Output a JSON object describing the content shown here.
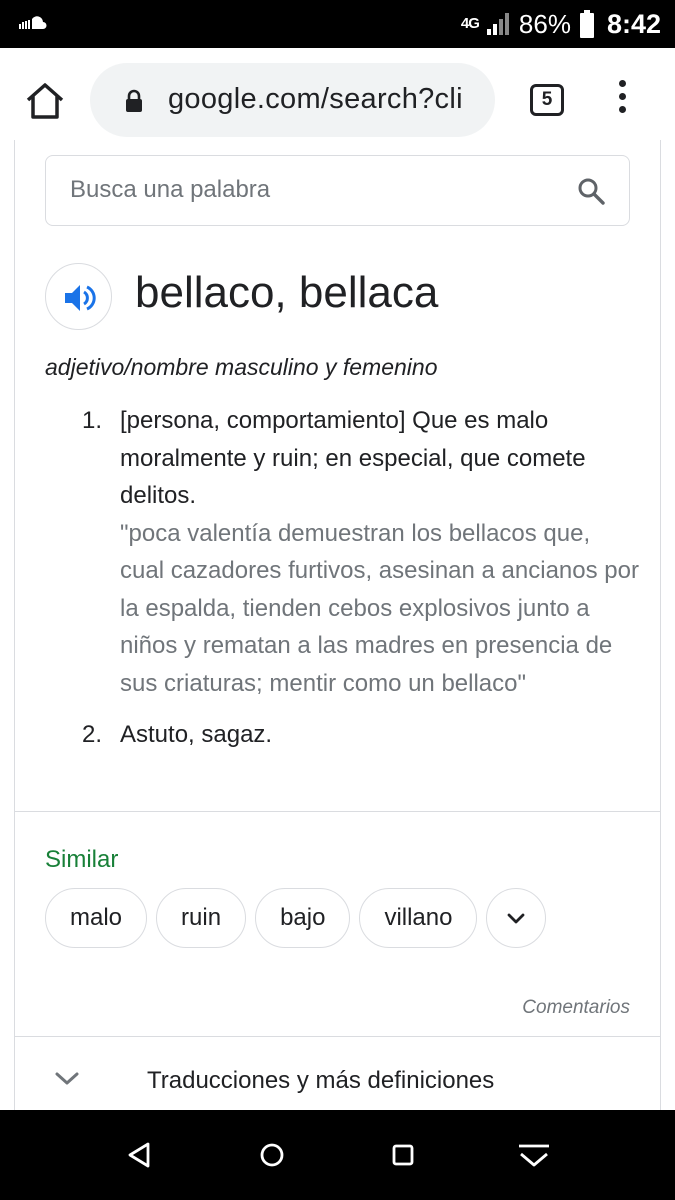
{
  "status_bar": {
    "network": "4G",
    "battery_percent": "86%",
    "time": "8:42"
  },
  "browser": {
    "url": "google.com/search?cli",
    "tab_count": "5"
  },
  "dictionary": {
    "search_placeholder": "Busca una palabra",
    "headword": "bellaco, bellaca",
    "part_of_speech": "adjetivo/nombre masculino y femenino",
    "definitions": [
      {
        "number": "1.",
        "text": "[persona, comportamiento] Que es malo moralmente y ruin; en especial, que comete delitos.",
        "example": "\"poca valentía demuestran los bellacos que, cual cazadores furtivos, asesinan a ancianos por la espalda, tienden cebos explosivos junto a niños y rematan a las madres en presencia de sus criaturas; mentir como un bellaco\""
      },
      {
        "number": "2.",
        "text": "Astuto, sagaz."
      }
    ],
    "similar_heading": "Similar",
    "similar_words": [
      "malo",
      "ruin",
      "bajo",
      "villano"
    ],
    "feedback_link": "Comentarios",
    "more_section_label": "Traducciones y más definiciones"
  },
  "colors": {
    "similar_green": "#188038",
    "speaker_blue": "#1a73e8",
    "secondary_text": "#70757a"
  }
}
